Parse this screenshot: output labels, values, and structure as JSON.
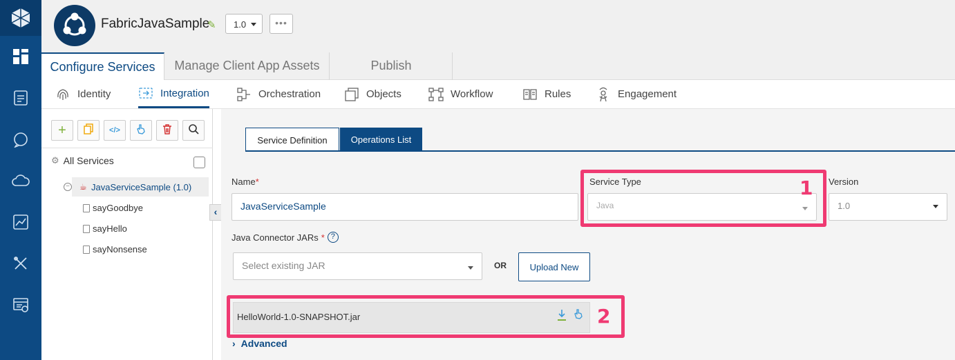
{
  "app": {
    "name": "FabricJavaSample",
    "version": "1.0",
    "more_label": "•••"
  },
  "main_tabs": [
    {
      "label": "Configure Services",
      "active": true
    },
    {
      "label": "Manage Client App Assets",
      "active": false
    },
    {
      "label": "Publish",
      "active": false
    }
  ],
  "sub_nav": [
    {
      "label": "Identity",
      "icon": "fingerprint-icon"
    },
    {
      "label": "Integration",
      "icon": "integration-icon",
      "active": true
    },
    {
      "label": "Orchestration",
      "icon": "orchestration-icon"
    },
    {
      "label": "Objects",
      "icon": "objects-icon"
    },
    {
      "label": "Workflow",
      "icon": "workflow-icon"
    },
    {
      "label": "Rules",
      "icon": "rules-icon"
    },
    {
      "label": "Engagement",
      "icon": "engagement-icon"
    }
  ],
  "left_panel": {
    "all_services_label": "All Services",
    "service_label": "JavaServiceSample (1.0)",
    "operations": [
      "sayGoodbye",
      "sayHello",
      "sayNonsense"
    ]
  },
  "content_tabs": {
    "definition": "Service Definition",
    "operations": "Operations List"
  },
  "form": {
    "name_label": "Name",
    "name_required": "*",
    "name_value": "JavaServiceSample",
    "service_type_label": "Service Type",
    "service_type_value": "Java",
    "version_label": "Version",
    "version_value": "1.0",
    "jar_label": "Java Connector JARs",
    "jar_required": "*",
    "jar_help": "?",
    "jar_placeholder": "Select existing JAR",
    "or_label": "OR",
    "upload_label": "Upload New",
    "jar_file": "HelloWorld-1.0-SNAPSHOT.jar",
    "advanced_label": "Advanced"
  },
  "annotations": {
    "one": "1",
    "two": "2"
  },
  "colors": {
    "brand": "#0d4a83",
    "highlight": "#ef3a72",
    "action_green": "#7fb13c"
  }
}
